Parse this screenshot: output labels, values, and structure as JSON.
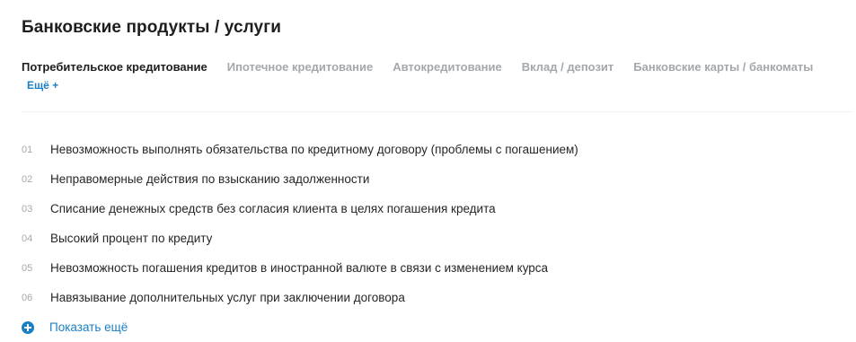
{
  "page": {
    "title": "Банковские продукты / услуги"
  },
  "tabs": [
    {
      "label": "Потребительское кредитование",
      "active": true
    },
    {
      "label": "Ипотечное кредитование",
      "active": false
    },
    {
      "label": "Автокредитование",
      "active": false
    },
    {
      "label": "Вклад / депозит",
      "active": false
    },
    {
      "label": "Банковские карты / банкоматы",
      "active": false
    }
  ],
  "more_tabs_label": "Ещё +",
  "items": [
    {
      "num": "01",
      "text": "Невозможность выполнять обязательства по кредитному договору (проблемы с погашением)"
    },
    {
      "num": "02",
      "text": "Неправомерные действия по взысканию задолженности"
    },
    {
      "num": "03",
      "text": "Списание денежных средств без согласия клиента в целях погашения кредита"
    },
    {
      "num": "04",
      "text": "Высокий процент по кредиту"
    },
    {
      "num": "05",
      "text": "Невозможность погашения кредитов в иностранной валюте в связи с изменением курса"
    },
    {
      "num": "06",
      "text": "Навязывание дополнительных услуг при заключении договора"
    }
  ],
  "show_more": {
    "label": "Показать ещё",
    "icon": "plus-circle-icon"
  },
  "colors": {
    "accent": "#1a7fc4",
    "muted": "#a4a8ad",
    "text": "#262626"
  }
}
